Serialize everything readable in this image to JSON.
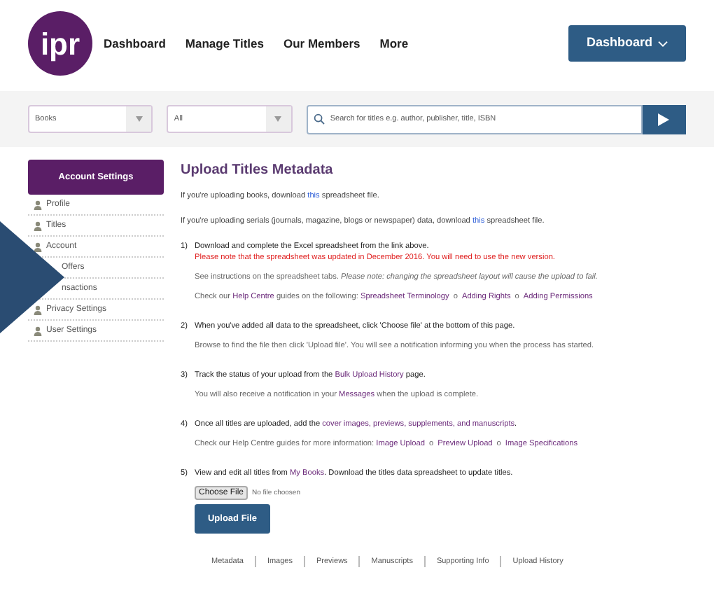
{
  "logo": {
    "text": "ipr"
  },
  "nav": [
    {
      "label": "Dashboard"
    },
    {
      "label": "Manage Titles"
    },
    {
      "label": "Our Members"
    },
    {
      "label": "More"
    }
  ],
  "dashboard_button": {
    "label": "Dashboard"
  },
  "search_bar": {
    "type_select": "Books",
    "filter_select": "All",
    "search": {
      "placeholder": "Search for titles e.g. author, publisher, title, ISBN"
    }
  },
  "sidebar": {
    "header": "Account Settings",
    "items": [
      {
        "label": "Profile",
        "icon": true
      },
      {
        "label": "Titles",
        "icon": true
      },
      {
        "label": "Account",
        "icon": true
      },
      {
        "label": "Offers",
        "icon": false
      },
      {
        "label": "nsactions",
        "icon": false
      },
      {
        "label": "Privacy Settings",
        "icon": true
      },
      {
        "label": "User Settings",
        "icon": true
      }
    ]
  },
  "main": {
    "title": "Upload Titles Metadata",
    "intro": [
      [
        {
          "kind": "text",
          "text": "If you're uploading books, download "
        },
        {
          "kind": "link",
          "text": "this"
        },
        {
          "kind": "text",
          "text": " spreadsheet file."
        }
      ],
      [
        {
          "kind": "text",
          "text": "If you're uploading serials (journals, magazine, blogs or newspaper) data, download "
        },
        {
          "kind": "link",
          "text": "this"
        },
        {
          "kind": "text",
          "text": " spreadsheet file."
        }
      ]
    ],
    "steps": [
      {
        "number": "1)",
        "heading": [
          {
            "kind": "text",
            "text": "Download and complete the Excel spreadsheet from the link above."
          }
        ],
        "warning": "Please note that the spreadsheet was updated in December 2016. You will need to use the new version.",
        "lines": [
          [
            {
              "kind": "text",
              "text": "See instructions on the spreadsheet tabs. *Please note: changing the spreadsheet layout will cause the upload to fail.*"
            }
          ],
          [
            {
              "kind": "text",
              "text": "Check our "
            },
            {
              "kind": "guide",
              "text": "Help Centre"
            },
            {
              "kind": "text",
              "text": " guides on the following: "
            },
            {
              "kind": "guide",
              "text": "Spreadsheet Terminology"
            },
            {
              "kind": "sep",
              "text": "o"
            },
            {
              "kind": "guide",
              "text": "Adding Rights"
            },
            {
              "kind": "sep",
              "text": "o"
            },
            {
              "kind": "guide",
              "text": "Adding Permissions"
            }
          ]
        ]
      },
      {
        "number": "2)",
        "heading": [
          {
            "kind": "text",
            "text": "When you've added all data to the spreadsheet, click 'Choose file' at the bottom of this page."
          }
        ],
        "lines": [
          [
            {
              "kind": "text",
              "text": "Browse to find the file then click 'Upload file'. You will see a notification informing you when the process has started."
            }
          ]
        ]
      },
      {
        "number": "3)",
        "heading": [
          {
            "kind": "text",
            "text": "Track the status of your upload from the "
          },
          {
            "kind": "guide",
            "text": "Bulk Upload History"
          },
          {
            "kind": "text",
            "text": " page."
          }
        ],
        "lines": [
          [
            {
              "kind": "text",
              "text": "You will also receive a notification in your "
            },
            {
              "kind": "guide",
              "text": "Messages"
            },
            {
              "kind": "text",
              "text": " when the upload is complete."
            }
          ]
        ]
      },
      {
        "number": "4)",
        "heading": [
          {
            "kind": "text",
            "text": "Once all titles are uploaded, add the "
          },
          {
            "kind": "guide",
            "text": "cover images, previews, supplements, and manuscripts"
          },
          {
            "kind": "text",
            "text": "."
          }
        ],
        "lines": [
          [
            {
              "kind": "text",
              "text": "Check our Help Centre guides for more information: "
            },
            {
              "kind": "guide",
              "text": "Image Upload"
            },
            {
              "kind": "sep",
              "text": "o"
            },
            {
              "kind": "guide",
              "text": "Preview Upload"
            },
            {
              "kind": "sep",
              "text": "o"
            },
            {
              "kind": "guide",
              "text": "Image Specifications"
            }
          ]
        ]
      },
      {
        "number": "5)",
        "heading": [
          {
            "kind": "text",
            "text": "View and edit all titles from "
          },
          {
            "kind": "guide",
            "text": "My Books"
          },
          {
            "kind": "text",
            "text": ". Download the titles data spreadsheet to update titles."
          }
        ]
      }
    ],
    "file_input": {
      "button": "Choose File",
      "status": "No file choosen"
    },
    "upload_button": "Upload File",
    "footer_tabs": [
      "Metadata",
      "Images",
      "Previews",
      "Manuscripts",
      "Supporting Info",
      "Upload History"
    ]
  }
}
